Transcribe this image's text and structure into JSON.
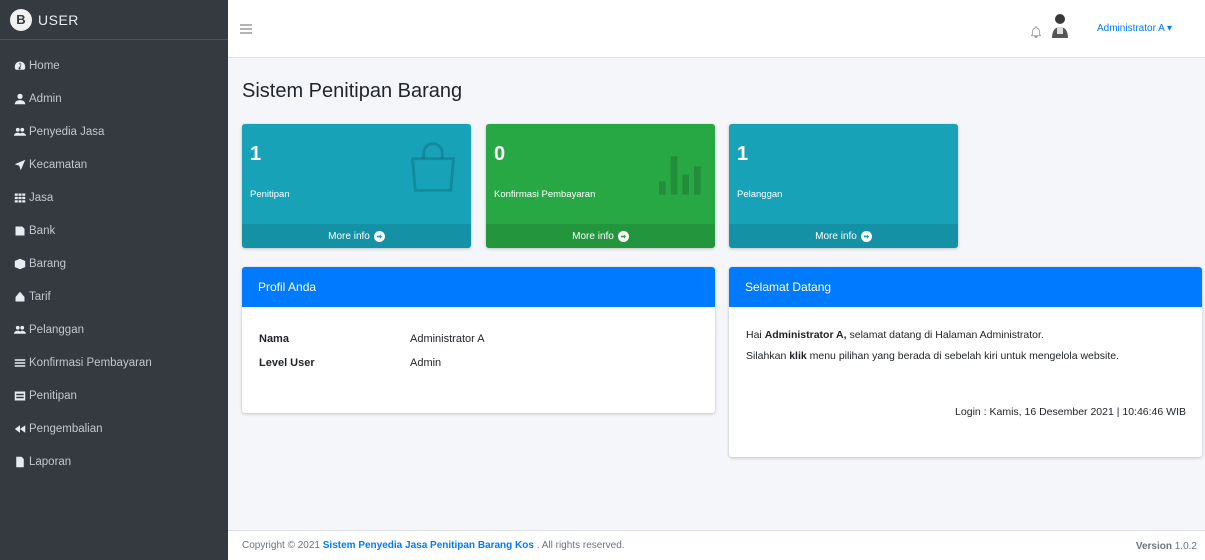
{
  "brand": {
    "logo_letter": "B",
    "title": "USER"
  },
  "sidebar": {
    "items": [
      {
        "label": "Home",
        "icon": "tachometer-icon"
      },
      {
        "label": "Admin",
        "icon": "user-icon"
      },
      {
        "label": "Penyedia Jasa",
        "icon": "users-icon"
      },
      {
        "label": "Kecamatan",
        "icon": "location-arrow-icon"
      },
      {
        "label": "Jasa",
        "icon": "grid-icon"
      },
      {
        "label": "Bank",
        "icon": "bank-icon"
      },
      {
        "label": "Barang",
        "icon": "box-icon"
      },
      {
        "label": "Tarif",
        "icon": "tag-icon"
      },
      {
        "label": "Pelanggan",
        "icon": "users-icon"
      },
      {
        "label": "Konfirmasi Pembayaran",
        "icon": "list-icon"
      },
      {
        "label": "Penitipan",
        "icon": "table-icon"
      },
      {
        "label": "Pengembalian",
        "icon": "backward-icon"
      },
      {
        "label": "Laporan",
        "icon": "file-icon"
      }
    ]
  },
  "topbar": {
    "user_name": "Administrator A"
  },
  "page": {
    "title": "Sistem Penitipan Barang"
  },
  "stats": [
    {
      "value": "1",
      "label": "Penitipan",
      "more": "More info",
      "color": "#17a2b8",
      "icon": "shopping-bag-icon"
    },
    {
      "value": "0",
      "label": "Konfirmasi Pembayaran",
      "more": "More info",
      "color": "#28a745",
      "icon": "bar-chart-icon"
    },
    {
      "value": "1",
      "label": "Pelanggan",
      "more": "More info",
      "color": "#17a2b8",
      "icon": ""
    }
  ],
  "profile": {
    "header": "Profil Anda",
    "rows": [
      {
        "label": "Nama",
        "value": "Administrator A"
      },
      {
        "label": "Level User",
        "value": "Admin"
      }
    ]
  },
  "welcome": {
    "header": "Selamat Datang",
    "greeting_prefix": "Hai ",
    "name": "Administrator A,",
    "greeting_suffix": " selamat datang di Halaman Administrator.",
    "instruction_prefix": "Silahkan ",
    "instruction_bold": "klik",
    "instruction_suffix": " menu pilihan yang berada di sebelah kiri untuk mengelola website.",
    "login_info": "Login : Kamis, 16 Desember 2021 | 10:46:46 WIB"
  },
  "footer": {
    "copyright_prefix": "Copyright © 2021 ",
    "site_name": "Sistem Penyedia Jasa Penitipan Barang Kos",
    "copyright_suffix": " . All rights reserved.",
    "version_label": "Version",
    "version_value": "1.0.2"
  },
  "colors": {
    "sidebar": "#343a40",
    "primary": "#007bff",
    "info": "#17a2b8",
    "success": "#28a745"
  }
}
